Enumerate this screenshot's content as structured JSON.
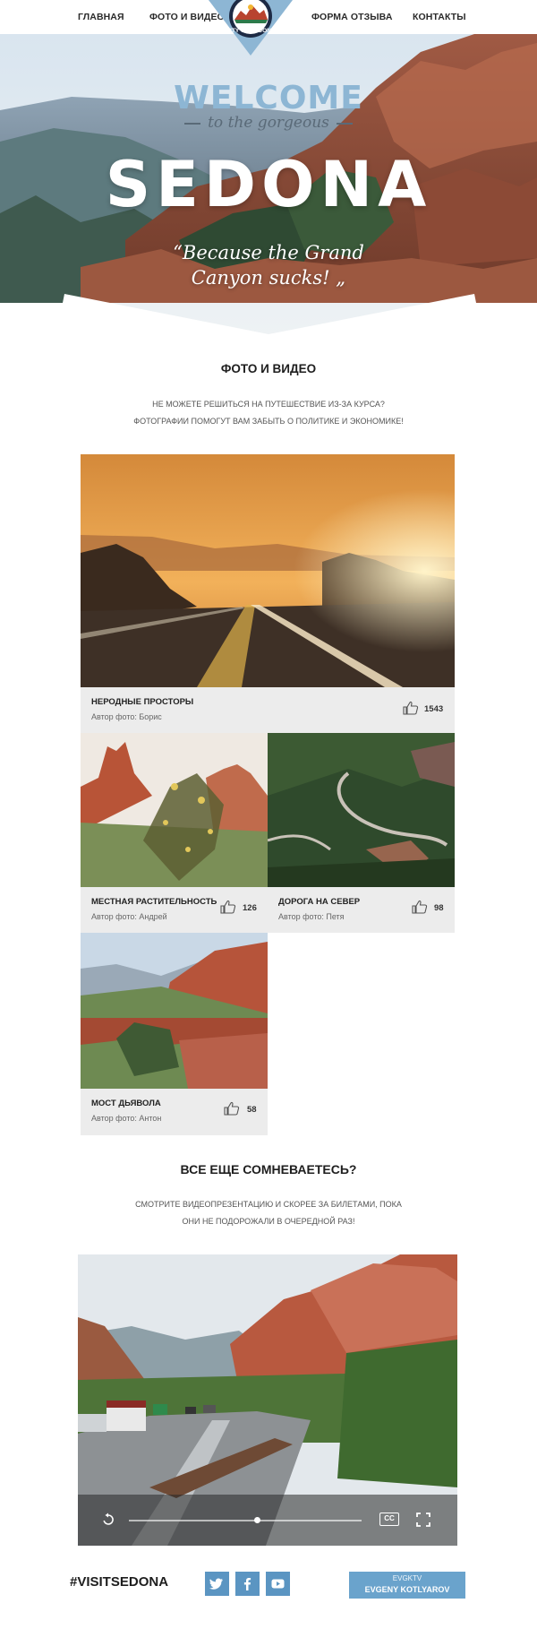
{
  "nav": {
    "items": [
      "ГЛАВНАЯ",
      "ФОТО И ВИДЕО",
      "ФОРМА ОТЗЫВА",
      "КОНТАКТЫ"
    ]
  },
  "logo": {
    "text": "CITY OF SEDONA",
    "icon": "city-seal"
  },
  "hero": {
    "welcome": "WELCOME",
    "tagline": "to the gorgeous",
    "title": "SEDONA",
    "quote_line1": "“Because the Grand",
    "quote_line2": "Canyon sucks! „"
  },
  "photos_section": {
    "title": "ФОТО И ВИДЕО",
    "subtitle_line1": "НЕ МОЖЕТЕ РЕШИТЬСЯ НА ПУТЕШЕСТВИЕ ИЗ-ЗА КУРСА?",
    "subtitle_line2": "ФОТОГРАФИИ ПОМОГУТ ВАМ ЗАБЫТЬ О ПОЛИТИКЕ И ЭКОНОМИКЕ!",
    "cards": [
      {
        "title": "НЕРОДНЫЕ ПРОСТОРЫ",
        "author": "Автор фото: Борис",
        "likes": "1543"
      },
      {
        "title": "МЕСТНАЯ РАСТИТЕЛЬНОСТЬ",
        "author": "Автор фото: Андрей",
        "likes": "126"
      },
      {
        "title": "ДОРОГА НА СЕВЕР",
        "author": "Автор фото: Петя",
        "likes": "98"
      },
      {
        "title": "МОСТ ДЬЯВОЛА",
        "author": "Автор фото: Антон",
        "likes": "58"
      }
    ]
  },
  "video_section": {
    "title": "ВСЕ ЕЩЕ СОМНЕВАЕТЕСЬ?",
    "subtitle_line1": "СМОТРИТЕ ВИДЕОПРЕЗЕНТАЦИЮ И СКОРЕЕ ЗА БИЛЕТАМИ, ПОКА",
    "subtitle_line2": "ОНИ НЕ ПОДОРОЖАЛИ В ОЧЕРЕДНОЙ РАЗ!",
    "cc_label": "CC",
    "progress": 0.55
  },
  "footer": {
    "hashtag": "#VISITSEDONA",
    "social": [
      "twitter-icon",
      "facebook-icon",
      "youtube-icon"
    ],
    "credit_line1": "EVGKTV",
    "credit_line2": "EVGENY KOTLYAROV"
  },
  "colors": {
    "accent": "#6aa3cc",
    "social": "#5b95c2",
    "card_bg": "#ececec"
  }
}
